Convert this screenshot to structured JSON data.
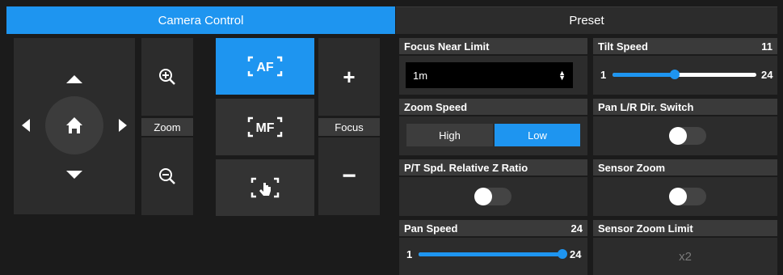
{
  "tabs": {
    "camera_control": "Camera Control",
    "preset": "Preset"
  },
  "camera": {
    "zoom_label": "Zoom",
    "focus_label": "Focus",
    "af_label": "AF",
    "mf_label": "MF",
    "focus_plus": "+",
    "focus_minus": "−"
  },
  "settings": {
    "focus_near_limit": {
      "label": "Focus Near Limit",
      "value": "1m"
    },
    "tilt_speed": {
      "label": "Tilt Speed",
      "value": "11",
      "min": "1",
      "max": "24",
      "level": 0.43
    },
    "zoom_speed": {
      "label": "Zoom Speed",
      "options": [
        "High",
        "Low"
      ],
      "selected": "Low"
    },
    "pan_lr_switch": {
      "label": "Pan L/R Dir. Switch",
      "on": false
    },
    "pt_spd_ratio": {
      "label": "P/T Spd. Relative Z Ratio",
      "on": false
    },
    "sensor_zoom": {
      "label": "Sensor Zoom",
      "on": false
    },
    "pan_speed": {
      "label": "Pan Speed",
      "value": "24",
      "min": "1",
      "max": "24",
      "level": 1.0
    },
    "sensor_zoom_limit": {
      "label": "Sensor Zoom Limit",
      "value": "x2"
    }
  },
  "colors": {
    "accent": "#1e95f0",
    "panel": "#2c2c2c",
    "header": "#3a3a3a"
  }
}
